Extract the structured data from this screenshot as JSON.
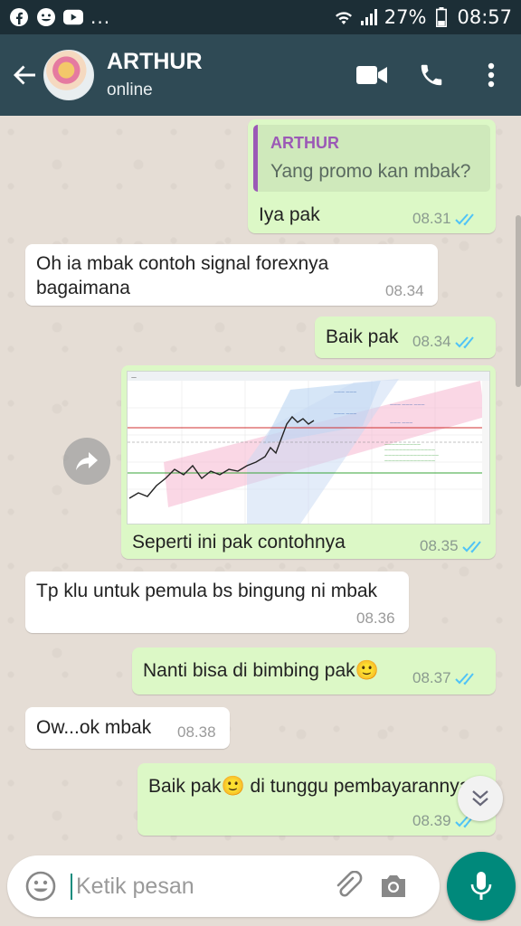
{
  "status_bar": {
    "battery": "27%",
    "time": "08:57",
    "more": "..."
  },
  "header": {
    "name": "ARTHUR",
    "status": "online"
  },
  "messages": [
    {
      "quote_name": "ARTHUR",
      "quote_text": "Yang promo kan mbak?",
      "text": "Iya pak",
      "time": "08.31"
    },
    {
      "text_line1": "Oh ia mbak contoh signal forexnya",
      "text_line2": "bagaimana",
      "time": "08.34"
    },
    {
      "text": "Baik pak",
      "time": "08.34"
    },
    {
      "caption": "Seperti ini pak contohnya",
      "time": "08.35"
    },
    {
      "text": "Tp klu untuk pemula bs bingung ni mbak",
      "time": "08.36"
    },
    {
      "text": "Nanti bisa di bimbing pak",
      "emoji": "🙂",
      "time": "08.37"
    },
    {
      "text": "Ow...ok mbak",
      "time": "08.38"
    },
    {
      "text_before": "Baik pak",
      "emoji": "🙂",
      "text_after": " di tunggu pembayarannya",
      "time": "08.39"
    }
  ],
  "input": {
    "placeholder": "Ketik pesan"
  },
  "colors": {
    "app_bar": "#2f4a55",
    "incoming": "#ffffff",
    "outgoing": "#dcf8c6",
    "read_tick": "#4fc3f7",
    "mic": "#00897b"
  }
}
